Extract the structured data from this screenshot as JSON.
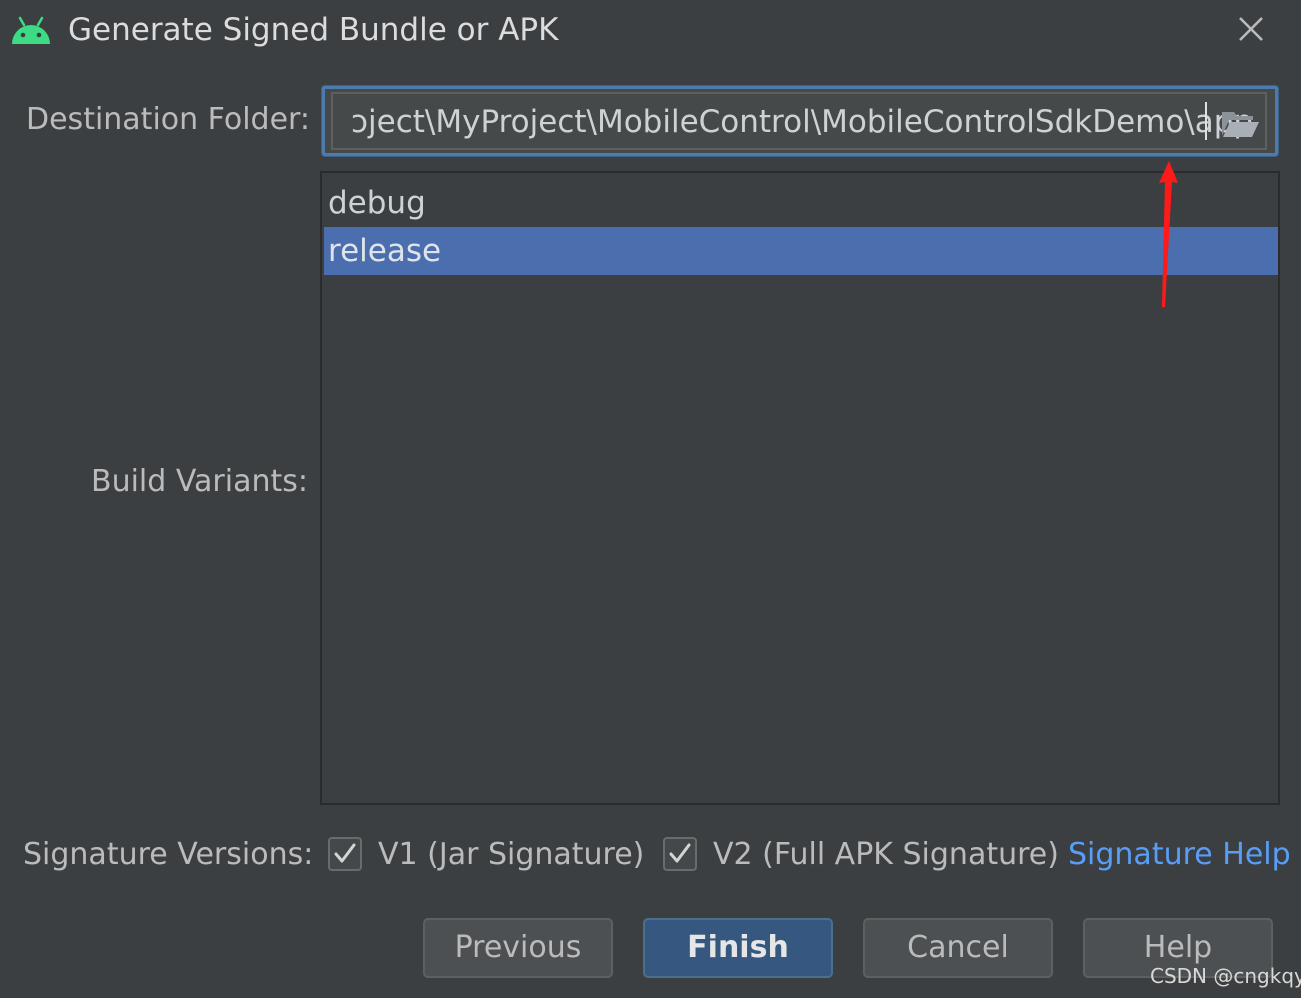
{
  "window": {
    "title": "Generate Signed Bundle or APK",
    "icon": "android-icon",
    "close_icon": "close-icon"
  },
  "destination": {
    "label": "Destination Folder:",
    "value": "ɔject\\MyProject\\MobileControl\\MobileControlSdkDemo\\app",
    "browse_icon": "folder-open-icon"
  },
  "build_variants": {
    "label": "Build Variants:",
    "items": [
      {
        "label": "debug",
        "selected": false
      },
      {
        "label": "release",
        "selected": true
      }
    ]
  },
  "signature": {
    "label": "Signature Versions:",
    "v1_label": "V1 (Jar Signature)",
    "v1_checked": true,
    "v2_label": "V2 (Full APK Signature)",
    "v2_checked": true,
    "help_link": "Signature Help"
  },
  "buttons": {
    "previous": "Previous",
    "finish": "Finish",
    "cancel": "Cancel",
    "help": "Help"
  },
  "watermark": "CSDN @cngkqy",
  "colors": {
    "background": "#3c3f41",
    "selection": "#4b6eaf",
    "focus_border": "#4c7cad",
    "link": "#589df6",
    "android_green": "#3ddc84",
    "annotation_arrow": "#ff1a1a",
    "finish_button": "#365880"
  }
}
